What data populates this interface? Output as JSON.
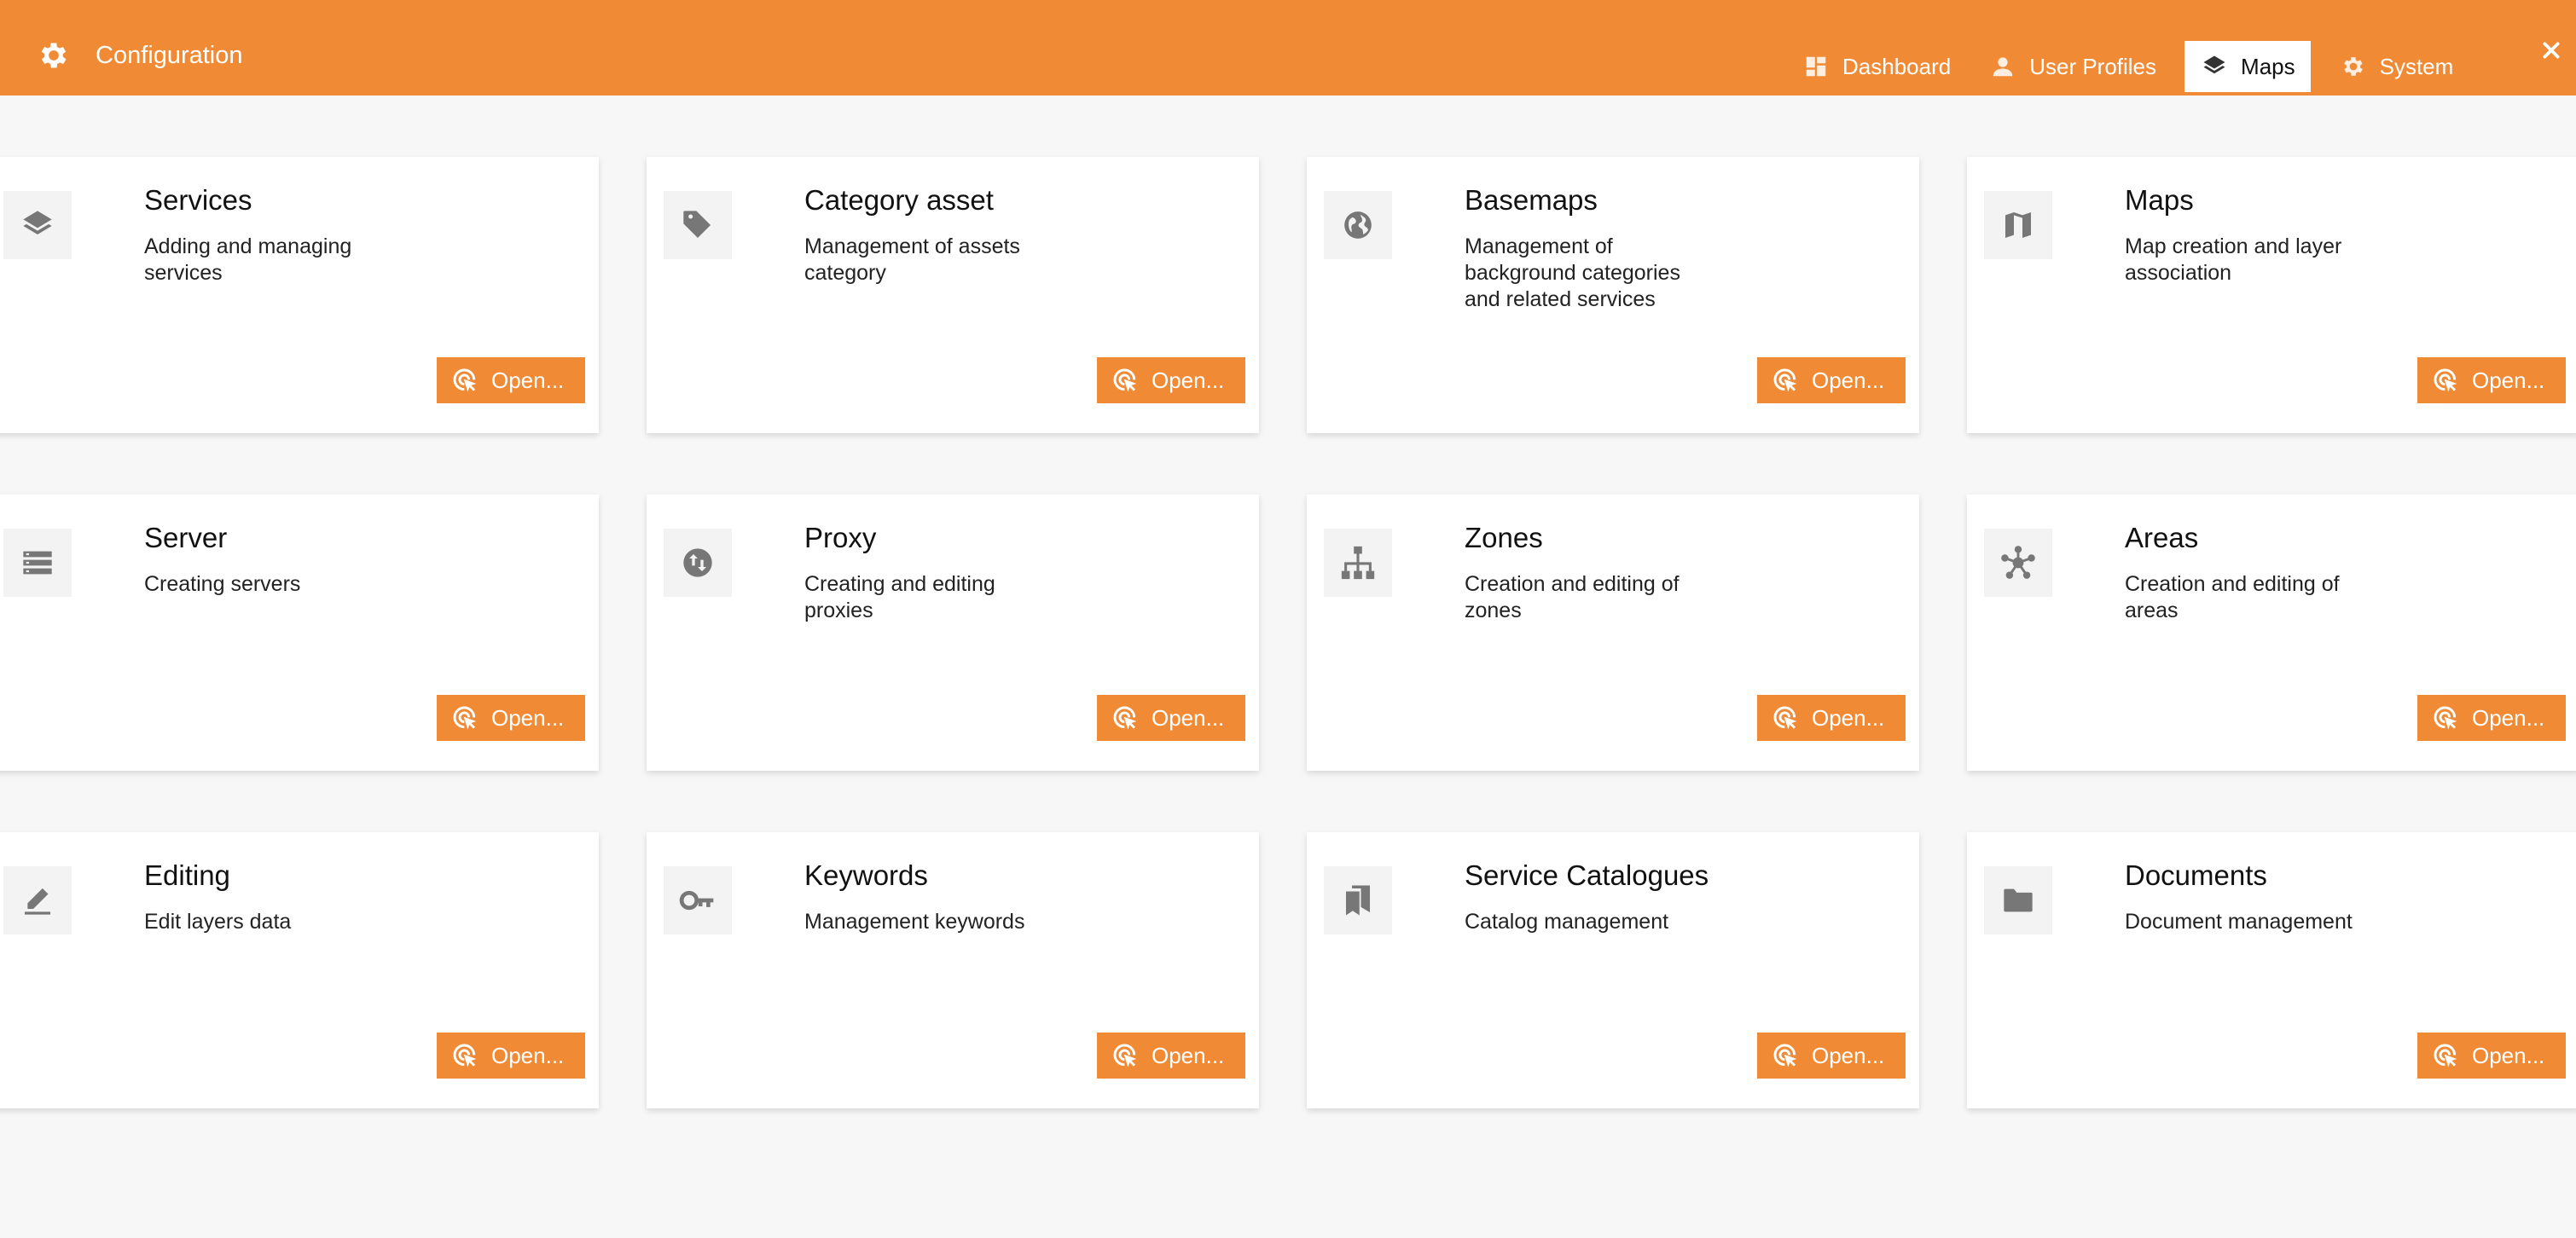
{
  "header": {
    "title": "Configuration",
    "icon": "gear-icon",
    "accent_color": "#f18a35"
  },
  "tabs": [
    {
      "label": "Dashboard",
      "icon": "dashboard-icon",
      "active": false
    },
    {
      "label": "User Profiles",
      "icon": "user-icon",
      "active": false
    },
    {
      "label": "Maps",
      "icon": "layers-icon",
      "active": true
    },
    {
      "label": "System",
      "icon": "gear-icon",
      "active": false
    }
  ],
  "close_icon": "close-icon",
  "open_label": "Open...",
  "cards": [
    {
      "title": "Services",
      "description": "Adding and managing services",
      "icon": "layers-icon"
    },
    {
      "title": "Category asset",
      "description": "Management of assets category",
      "icon": "tag-icon"
    },
    {
      "title": "Basemaps",
      "description": "Management of background categories and related services",
      "icon": "globe-icon"
    },
    {
      "title": "Maps",
      "description": "Map creation and layer association",
      "icon": "map-icon"
    },
    {
      "title": "Server",
      "description": "Creating servers",
      "icon": "server-icon"
    },
    {
      "title": "Proxy",
      "description": "Creating and editing proxies",
      "icon": "swap-icon"
    },
    {
      "title": "Zones",
      "description": "Creation and editing of zones",
      "icon": "hierarchy-icon"
    },
    {
      "title": "Areas",
      "description": "Creation and editing of areas",
      "icon": "hub-icon"
    },
    {
      "title": "Editing",
      "description": "Edit layers data",
      "icon": "edit-icon"
    },
    {
      "title": "Keywords",
      "description": "Management keywords",
      "icon": "key-icon"
    },
    {
      "title": "Service Catalogues",
      "description": "Catalog management",
      "icon": "bookmarks-icon"
    },
    {
      "title": "Documents",
      "description": "Document management",
      "icon": "folder-icon"
    }
  ]
}
